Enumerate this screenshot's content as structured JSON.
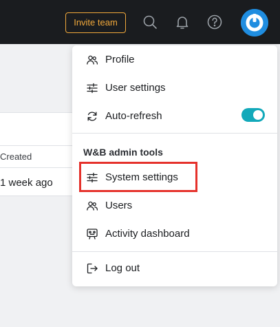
{
  "header": {
    "invite_label": "Invite team",
    "icons": [
      "search-icon",
      "bell-icon",
      "help-icon",
      "avatar"
    ]
  },
  "background": {
    "column_header": "Created",
    "cell_value": "1 week ago"
  },
  "menu": {
    "items": [
      {
        "label": "Profile",
        "icon": "users-icon"
      },
      {
        "label": "User settings",
        "icon": "sliders-icon"
      },
      {
        "label": "Auto-refresh",
        "icon": "refresh-icon",
        "toggle_on": true
      }
    ],
    "admin_section_title": "W&B admin tools",
    "admin_items": [
      {
        "label": "System settings",
        "icon": "sliders-icon",
        "highlighted": true
      },
      {
        "label": "Users",
        "icon": "users-icon"
      },
      {
        "label": "Activity dashboard",
        "icon": "dashboard-icon"
      }
    ],
    "logout_label": "Log out"
  },
  "colors": {
    "topbar": "#1a1c1f",
    "invite_accent": "#f2a93b",
    "toggle_on": "#13a9ba",
    "avatar": "#1f8de0",
    "highlight": "#e5312b"
  }
}
